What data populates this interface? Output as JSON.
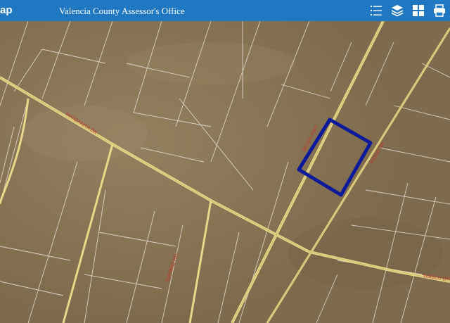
{
  "header": {
    "brand": "ap",
    "title": "Valencia County Assessor's Office"
  },
  "toolbar": {
    "items": [
      {
        "name": "legend-list-icon"
      },
      {
        "name": "layers-icon"
      },
      {
        "name": "basemap-gallery-icon"
      },
      {
        "name": "print-icon"
      }
    ]
  },
  "map": {
    "road_labels": [
      {
        "text": "MANZANITA DR"
      },
      {
        "text": "BELEN HWY"
      },
      {
        "text": "RIDGE DR"
      },
      {
        "text": "ENEBRO RD"
      },
      {
        "text": "DIABLO DR"
      }
    ],
    "colors": {
      "terrain": "#8a7455",
      "road": "#e8d98a",
      "parcel_line": "#e9e4da",
      "selected_parcel": "#0d1a9a",
      "header": "#1f78c1"
    }
  }
}
